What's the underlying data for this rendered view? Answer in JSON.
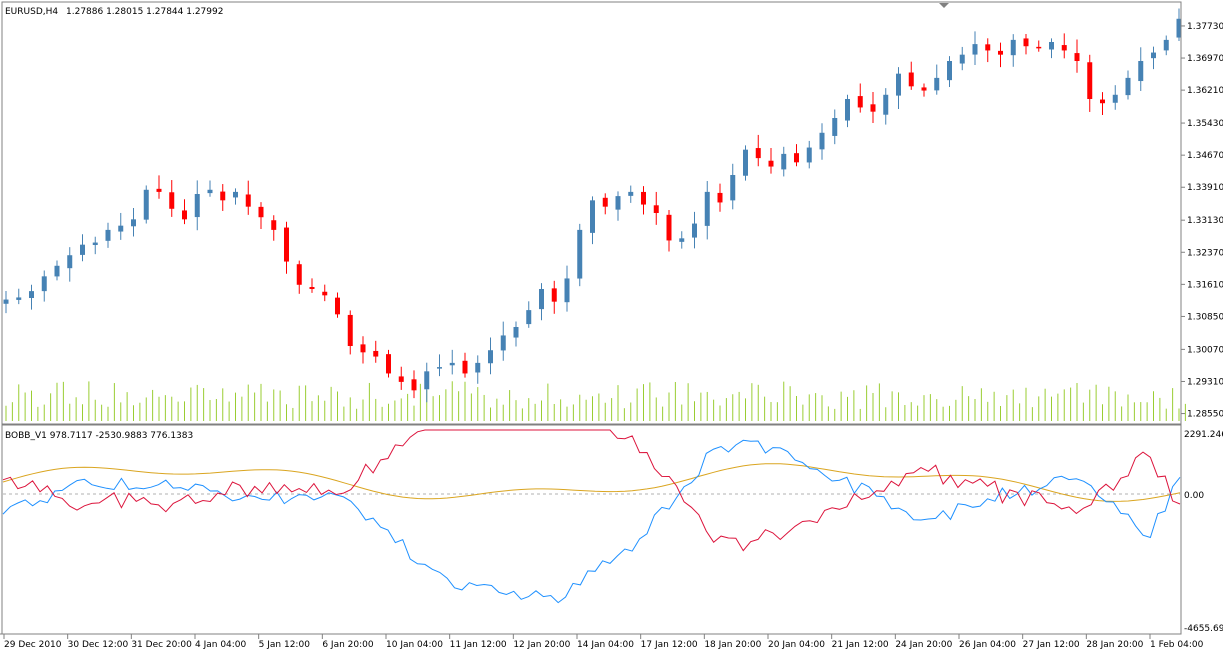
{
  "header": {
    "symbol": "EURUSD,H4",
    "ohlc": "1.27886 1.28015 1.27844 1.27992"
  },
  "indicator": {
    "label": "BOBB_V1 978.7117 -2530.9883 776.1383",
    "y_labels": [
      "2291.246",
      "0.00",
      "-4655.69"
    ]
  },
  "colors": {
    "bull": "#4682b4",
    "bear": "#ff0000",
    "volume": "#9acd32",
    "ind_blue": "#1e90ff",
    "ind_red": "#dc143c",
    "ind_orange": "#daa520",
    "border": "#808080"
  },
  "chart_data": [
    {
      "type": "candlestick",
      "title": "EURUSD,H4",
      "y_ticks": [
        "1.37730",
        "1.36970",
        "1.36210",
        "1.35430",
        "1.34670",
        "1.33910",
        "1.33130",
        "1.32370",
        "1.31610",
        "1.30850",
        "1.30070",
        "1.29310",
        "1.28550"
      ],
      "ylim": [
        1.2835,
        1.3825
      ],
      "x_ticks": [
        "29 Dec 2010",
        "30 Dec 12:00",
        "31 Dec 20:00",
        "4 Jan 04:00",
        "5 Jan 12:00",
        "6 Jan 20:00",
        "10 Jan 04:00",
        "11 Jan 12:00",
        "12 Jan 20:00",
        "14 Jan 04:00",
        "17 Jan 12:00",
        "18 Jan 20:00",
        "20 Jan 04:00",
        "21 Jan 12:00",
        "24 Jan 20:00",
        "26 Jan 04:00",
        "27 Jan 12:00",
        "28 Jan 20:00",
        "1 Feb 04:00"
      ],
      "close_series": [
        1.3125,
        1.313,
        1.3145,
        1.318,
        1.3205,
        1.323,
        1.3255,
        1.326,
        1.329,
        1.33,
        1.3315,
        1.3385,
        1.338,
        1.334,
        1.3315,
        1.3375,
        1.3385,
        1.336,
        1.338,
        1.3345,
        1.332,
        1.329,
        1.3215,
        1.316,
        1.315,
        1.3135,
        1.309,
        1.3015,
        1.3,
        1.299,
        1.295,
        1.293,
        1.291,
        1.2955,
        1.2965,
        1.2975,
        1.295,
        1.2975,
        1.3005,
        1.304,
        1.306,
        1.31,
        1.315,
        1.312,
        1.3175,
        1.329,
        1.336,
        1.3345,
        1.337,
        1.338,
        1.335,
        1.333,
        1.3265,
        1.327,
        1.3305,
        1.338,
        1.3355,
        1.342,
        1.348,
        1.346,
        1.344,
        1.347,
        1.345,
        1.3485,
        1.352,
        1.3555,
        1.36,
        1.358,
        1.357,
        1.361,
        1.366,
        1.363,
        1.362,
        1.365,
        1.369,
        1.3705,
        1.373,
        1.3715,
        1.3705,
        1.374,
        1.3725,
        1.372,
        1.3735,
        1.3715,
        1.369,
        1.36,
        1.359,
        1.361,
        1.365,
        1.369,
        1.371,
        1.374,
        1.379
      ],
      "indicator_series": [
        {
          "name": "BOBB_V1 blue",
          "color": "#1e90ff"
        },
        {
          "name": "BOBB_V1 red",
          "color": "#dc143c"
        },
        {
          "name": "BOBB_V1 orange",
          "color": "#daa520"
        }
      ]
    }
  ]
}
